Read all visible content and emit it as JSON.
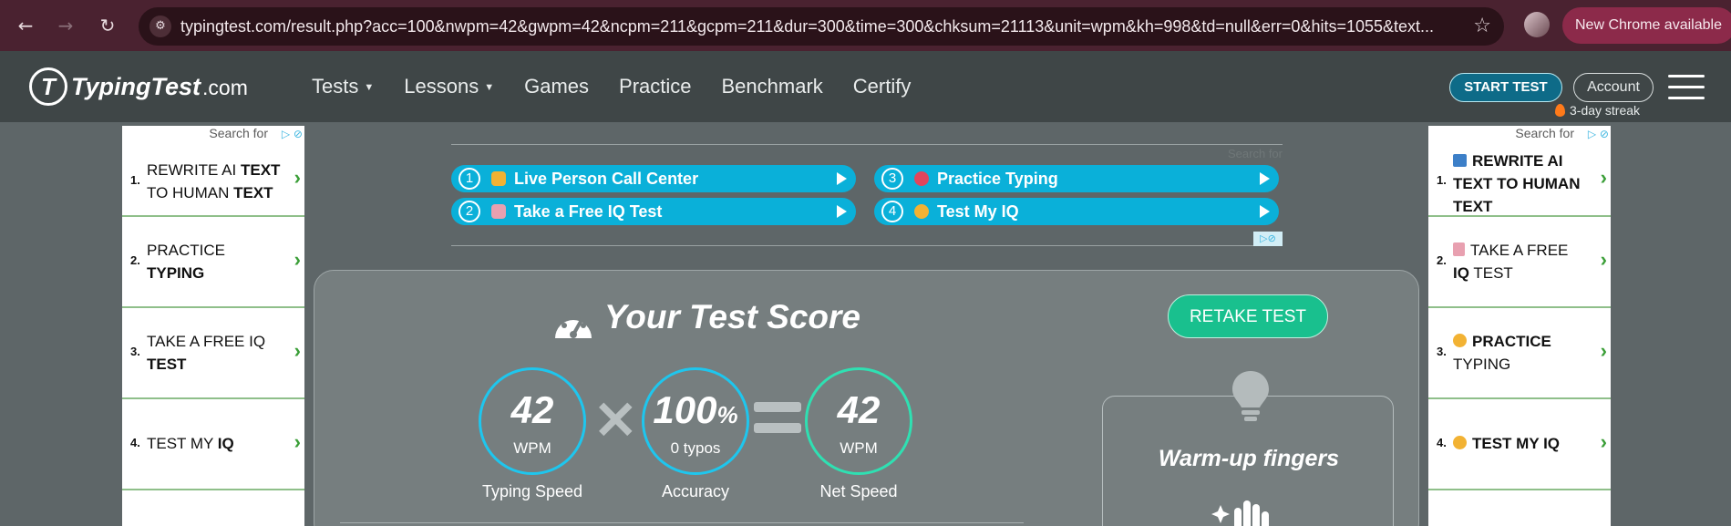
{
  "browser": {
    "url": "typingtest.com/result.php?acc=100&nwpm=42&gwpm=42&ncpm=211&gcpm=211&dur=300&time=300&chksum=21113&unit=wpm&kh=998&td=null&err=0&hits=1055&text...",
    "update_label": "New Chrome available"
  },
  "header": {
    "logo_text": "TypingTest",
    "logo_suffix": ".com",
    "nav": [
      "Tests",
      "Lessons",
      "Games",
      "Practice",
      "Benchmark",
      "Certify"
    ],
    "start_test_label": "START TEST",
    "account_label": "Account",
    "streak_label": "3-day streak"
  },
  "left_ad": {
    "search_for": "Search for",
    "items": [
      {
        "num": "1.",
        "pre": "REWRITE AI ",
        "bold": "TEXT",
        "post": " TO HUMAN ",
        "bold2": "TEXT"
      },
      {
        "num": "2.",
        "pre": "PRACTICE ",
        "bold": "TYPING",
        "post": "",
        "bold2": ""
      },
      {
        "num": "3.",
        "pre": "TAKE A FREE IQ ",
        "bold": "TEST",
        "post": "",
        "bold2": ""
      },
      {
        "num": "4.",
        "pre": "TEST MY ",
        "bold": "IQ",
        "post": "",
        "bold2": ""
      }
    ]
  },
  "right_ad": {
    "search_for": "Search for",
    "items": [
      {
        "num": "1.",
        "pre": "REWRITE AI ",
        "bold": "TEXT",
        "post": " TO HUMAN ",
        "bold2": "TEXT"
      },
      {
        "num": "2.",
        "pre": "TAKE A FREE ",
        "bold": "IQ",
        "post": " TEST",
        "bold2": ""
      },
      {
        "num": "3.",
        "pre": "PRACTICE ",
        "bold": "",
        "post": "TYPING",
        "bold2": ""
      },
      {
        "num": "4.",
        "pre": "TEST MY IQ",
        "bold": "",
        "post": "",
        "bold2": ""
      }
    ]
  },
  "banner_ad": {
    "search_for": "Search for",
    "items": [
      {
        "num": "1",
        "label": "Live Person Call Center",
        "emoji_color": "#f2b233"
      },
      {
        "num": "3",
        "label": "Practice Typing",
        "emoji_color": "#e0455c"
      },
      {
        "num": "2",
        "label": "Take a Free IQ Test",
        "emoji_color": "#e8a0b0"
      },
      {
        "num": "4",
        "label": "Test My IQ",
        "emoji_color": "#f2b233"
      }
    ]
  },
  "score": {
    "title": "Your Test Score",
    "retake_label": "RETAKE TEST",
    "typing_speed": {
      "value": "42",
      "unit": "WPM",
      "label": "Typing Speed"
    },
    "accuracy": {
      "value": "100",
      "unit": "%",
      "sub": "0 typos",
      "label": "Accuracy"
    },
    "net_speed": {
      "value": "42",
      "unit": "WPM",
      "label": "Net Speed"
    },
    "tip_title": "Warm-up fingers"
  },
  "colors": {
    "accent_blue": "#1ec6ee",
    "accent_green": "#19c08e",
    "ad_blue": "#0ab0d9"
  }
}
